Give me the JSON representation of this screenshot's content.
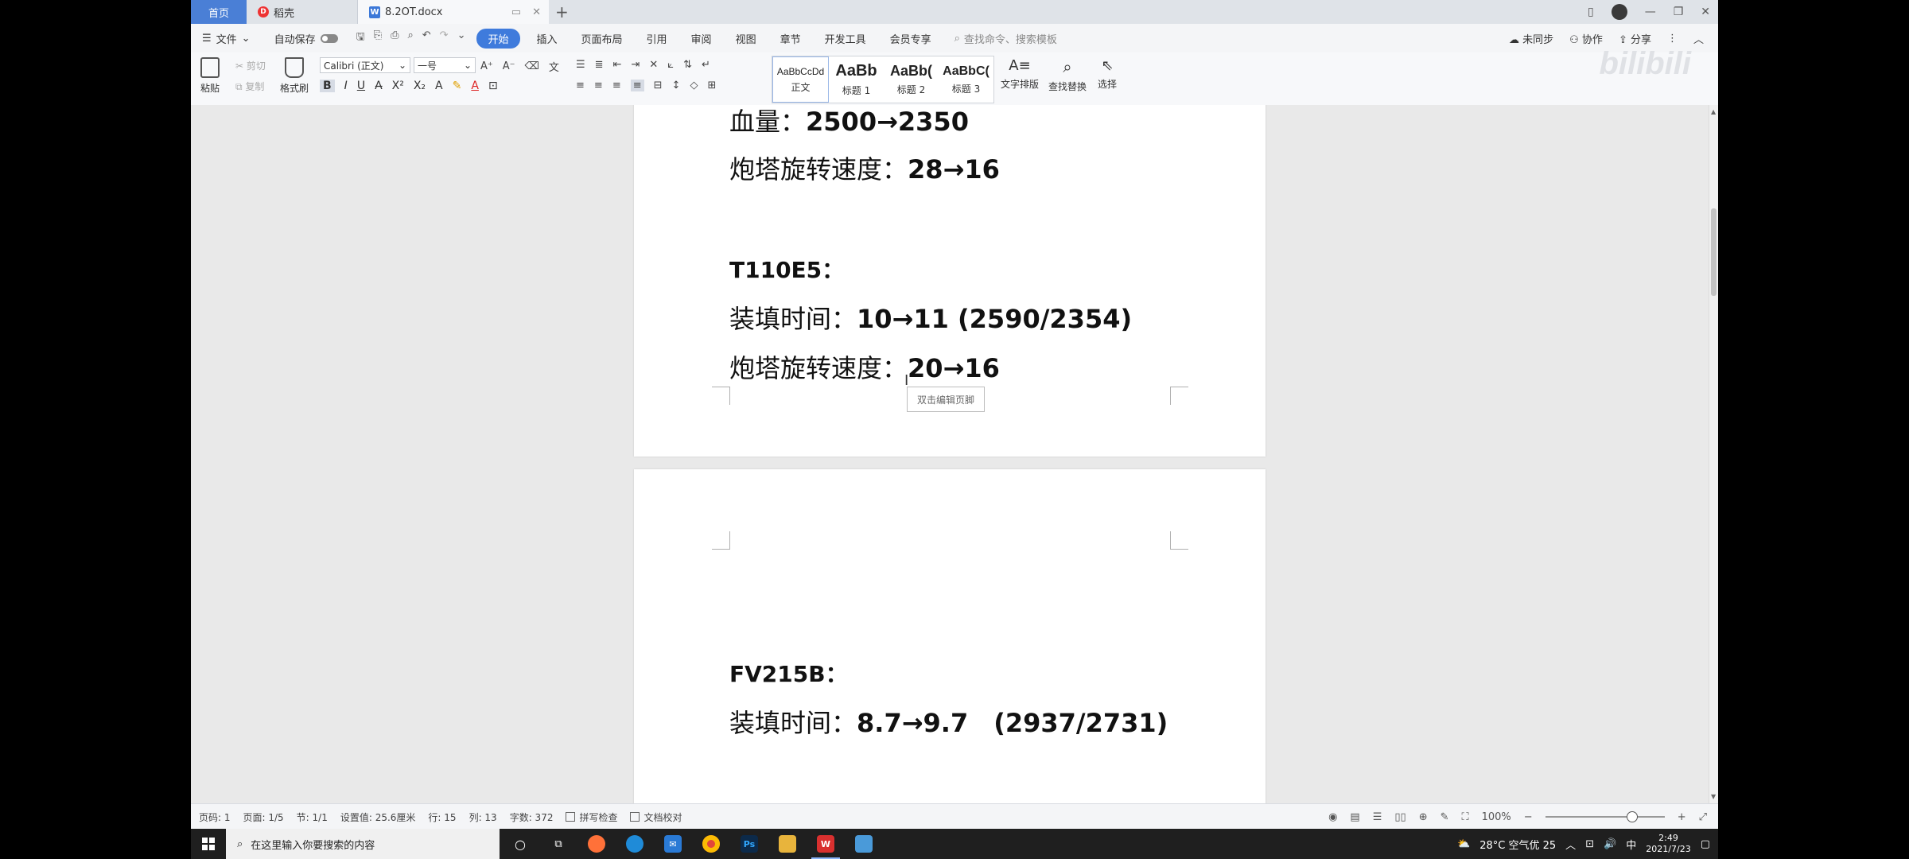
{
  "tabs": {
    "home": "首页",
    "wps": "稻壳",
    "doc": "8.2OT.docx",
    "doc_icon": "W"
  },
  "menu": {
    "file": "文件",
    "autosave": "自动保存",
    "items": [
      "开始",
      "插入",
      "页面布局",
      "引用",
      "审阅",
      "视图",
      "章节",
      "开发工具",
      "会员专享"
    ],
    "search_placeholder": "查找命令、搜索模板",
    "sync": "未同步",
    "collab": "协作",
    "share": "分享"
  },
  "ribbon": {
    "paste": "粘贴",
    "cut": "剪切",
    "copy": "复制",
    "format_painter": "格式刷",
    "font_name": "Calibri (正文)",
    "font_size": "一号",
    "styles": [
      {
        "preview": "AaBbCcDd",
        "name": "正文"
      },
      {
        "preview": "AaBb",
        "name": "标题 1"
      },
      {
        "preview": "AaBb(",
        "name": "标题 2"
      },
      {
        "preview": "AaBbC(",
        "name": "标题 3"
      }
    ],
    "text_layout": "文字排版",
    "find_replace": "查找替换",
    "select": "选择",
    "watermark": "bilibili"
  },
  "document": {
    "page1": {
      "line0_label": "血量：",
      "line0_value": "2500→2350",
      "line1_label": "炮塔旋转速度：",
      "line1_value": "28→16",
      "heading": "T110E5：",
      "line2_label": "装填时间：",
      "line2_value": "10→11 (2590/2354)",
      "line3_label": "炮塔旋转速度：",
      "line3_value": "20→16",
      "footer_tip": "双击编辑页脚"
    },
    "page2": {
      "heading": "FV215B：",
      "line1_label": "装填时间：",
      "line1_value": "8.7→9.7　(2937/2731)"
    }
  },
  "status": {
    "page_code": "页码: 1",
    "pages": "页面: 1/5",
    "section": "节: 1/1",
    "setting": "设置值: 25.6厘米",
    "row": "行: 15",
    "col": "列: 13",
    "words": "字数: 372",
    "spellcheck": "拼写检查",
    "proofread": "文档校对",
    "zoom": "100%",
    "zoom_fraction": 0.68
  },
  "taskbar": {
    "search_placeholder": "在这里输入你要搜索的内容",
    "weather": "28°C 空气优 25",
    "ime": "中",
    "time": "2:49",
    "date": "2021/7/23"
  }
}
